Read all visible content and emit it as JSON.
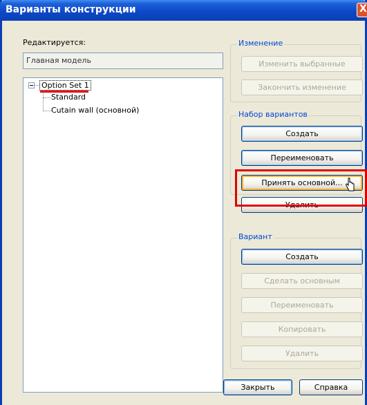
{
  "window": {
    "title": "Варианты конструкции",
    "close_glyph": "X"
  },
  "left": {
    "editing_label": "Редактируется:",
    "editing_value": "Главная модель",
    "tree": {
      "root": "Option Set 1",
      "children": [
        "Standard",
        "Cutain wall (основной)"
      ]
    }
  },
  "change_group": {
    "legend": "Изменение",
    "edit_selected": "Изменить выбранные",
    "finish_edit": "Закончить изменение"
  },
  "set_group": {
    "legend": "Набор вариантов",
    "create": "Создать",
    "rename": "Переименовать",
    "accept_primary": "Принять основной...",
    "delete": "Удалить"
  },
  "option_group": {
    "legend": "Вариант",
    "create": "Создать",
    "make_primary": "Сделать основным",
    "rename": "Переименовать",
    "copy": "Копировать",
    "delete": "Удалить"
  },
  "footer": {
    "close": "Закрыть",
    "help": "Справка"
  },
  "colors": {
    "highlight_box": "#e20000",
    "titlebar": "#0a3fb4",
    "group_legend": "#0046d5"
  }
}
